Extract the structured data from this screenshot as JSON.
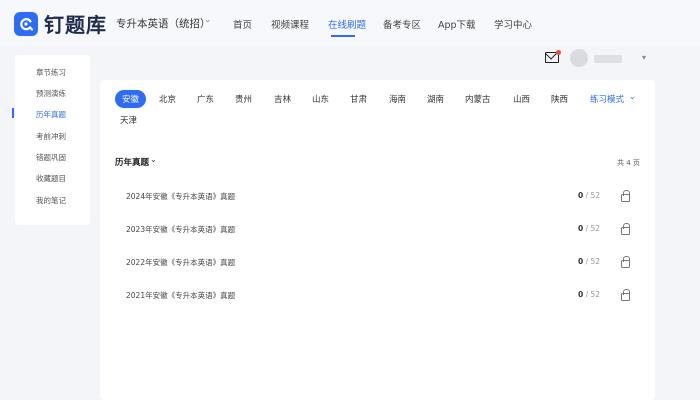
{
  "brand": {
    "name": "钉题库",
    "color": "#2d6cf6"
  },
  "header": {
    "course": "专升本英语（统招）",
    "nav": [
      "首页",
      "视频课程",
      "在线刷题",
      "备考专区",
      "App下载",
      "学习中心"
    ],
    "active_nav": "在线刷题"
  },
  "sidebar": {
    "items": [
      "章节练习",
      "预测演练",
      "历年真题",
      "考前冲刺",
      "错题巩固",
      "收藏题目",
      "我的笔记"
    ],
    "active": "历年真题"
  },
  "regions": {
    "items": [
      "安徽",
      "北京",
      "广东",
      "贵州",
      "吉林",
      "山东",
      "甘肃",
      "海南",
      "湖南",
      "内蒙古",
      "山西",
      "陕西",
      "天津"
    ],
    "active": "安徽"
  },
  "mode_select": {
    "label": "练习模式"
  },
  "section": {
    "title": "历年真题",
    "count_label": "共 4 页"
  },
  "papers": [
    {
      "title": "2024年安徽《专升本英语》真题",
      "done": "0",
      "total": "52"
    },
    {
      "title": "2023年安徽《专升本英语》真题",
      "done": "0",
      "total": "52"
    },
    {
      "title": "2022年安徽《专升本英语》真题",
      "done": "0",
      "total": "52"
    },
    {
      "title": "2021年安徽《专升本英语》真题",
      "done": "0",
      "total": "52"
    }
  ],
  "icons": {
    "mail": "mail-icon",
    "lock": "lock-icon",
    "dropdown": "chevron-down-icon"
  }
}
